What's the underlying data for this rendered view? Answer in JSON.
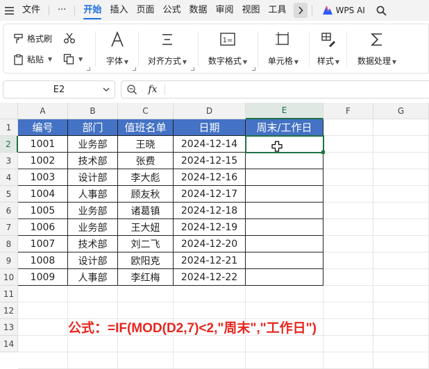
{
  "menu": {
    "items": [
      {
        "label": "文件"
      },
      {
        "label": "···"
      },
      {
        "label": "开始",
        "active": true
      },
      {
        "label": "插入"
      },
      {
        "label": "页面"
      },
      {
        "label": "公式"
      },
      {
        "label": "数据"
      },
      {
        "label": "审阅"
      },
      {
        "label": "视图"
      },
      {
        "label": "工具"
      }
    ],
    "wps_ai_label": "WPS AI"
  },
  "ribbon": {
    "format_painter": "格式刷",
    "paste": "粘贴",
    "font": "字体",
    "align": "对齐方式",
    "number_format": "数字格式",
    "cell": "单元格",
    "style": "样式",
    "data_process": "数据处理"
  },
  "formula_bar": {
    "name_box": "E2",
    "fx": "fx",
    "content": ""
  },
  "sheet": {
    "columns": [
      "A",
      "B",
      "C",
      "D",
      "E",
      "F",
      "G"
    ],
    "rows": [
      "1",
      "2",
      "3",
      "4",
      "5",
      "6",
      "7",
      "8",
      "9",
      "10",
      "11",
      "12",
      "13",
      "14"
    ],
    "selected_column": "E",
    "selected_row": "2",
    "headers": [
      "编号",
      "部门",
      "值班名单",
      "日期",
      "周末/工作日"
    ],
    "data": [
      [
        "1001",
        "业务部",
        "王晓",
        "2024-12-14",
        ""
      ],
      [
        "1002",
        "技术部",
        "张费",
        "2024-12-15",
        ""
      ],
      [
        "1003",
        "设计部",
        "李大彪",
        "2024-12-16",
        ""
      ],
      [
        "1004",
        "人事部",
        "顾友秋",
        "2024-12-17",
        ""
      ],
      [
        "1005",
        "业务部",
        "诸葛镇",
        "2024-12-18",
        ""
      ],
      [
        "1006",
        "业务部",
        "王大妞",
        "2024-12-19",
        ""
      ],
      [
        "1007",
        "技术部",
        "刘二飞",
        "2024-12-20",
        ""
      ],
      [
        "1008",
        "设计部",
        "欧阳克",
        "2024-12-21",
        ""
      ],
      [
        "1009",
        "人事部",
        "李红梅",
        "2024-12-22",
        ""
      ]
    ]
  },
  "annotation": "公式：=IF(MOD(D2,7)<2,\"周末\",\"工作日\")",
  "colors": {
    "accent": "#1a6fe0",
    "header_fill": "#4472c4",
    "selection": "#1e7145",
    "annotation": "#e8261e"
  }
}
